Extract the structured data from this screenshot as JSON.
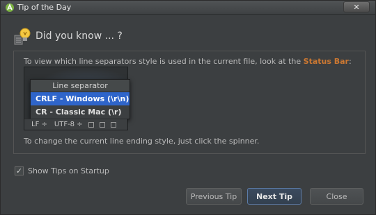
{
  "window": {
    "title": "Tip of the Day",
    "close_glyph": "✕"
  },
  "header": {
    "title": "Did you know ... ?"
  },
  "tip": {
    "line1_prefix": "To view which line separators style is used in the current file, look at the ",
    "line1_highlight": "Status Bar",
    "line1_suffix": ":",
    "line2": "To change the current line ending style, just click the spinner.",
    "highlight_color": "#cc7832"
  },
  "illustration": {
    "popup_title": "Line separator",
    "items": [
      {
        "label": "CRLF - Windows (\\r\\n)",
        "selected": true
      },
      {
        "label": "CR - Classic Mac (\\r)",
        "selected": false
      }
    ],
    "status_items": [
      "LF ÷",
      "UTF-8 ÷"
    ]
  },
  "options": {
    "show_tips_label": "Show Tips on Startup",
    "show_tips_checked": true,
    "check_glyph": "✓"
  },
  "buttons": {
    "previous": "Previous Tip",
    "next": "Next Tip",
    "close": "Close"
  }
}
